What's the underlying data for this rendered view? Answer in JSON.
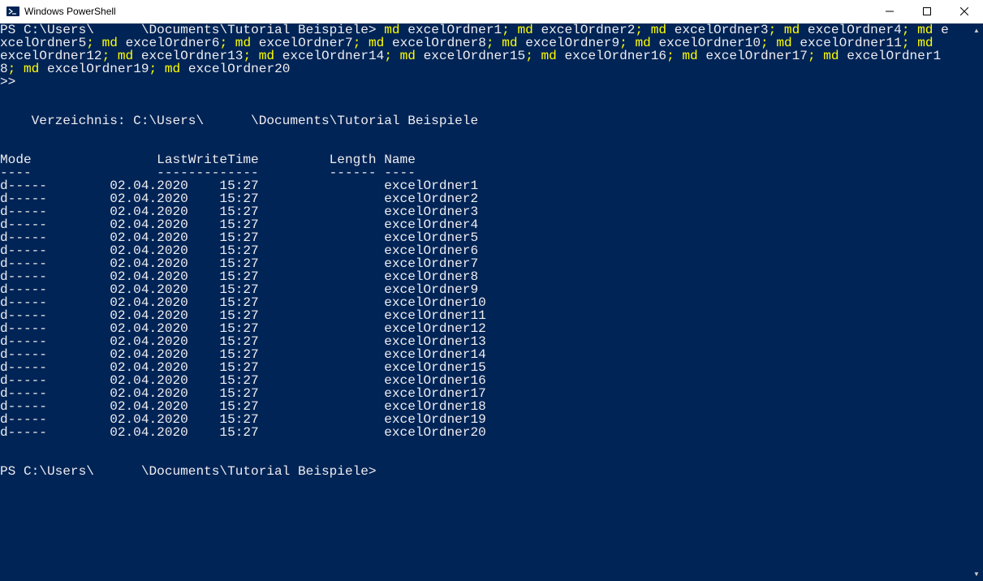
{
  "window": {
    "title": "Windows PowerShell"
  },
  "prompt_path": "PS C:\\Users\\      \\Documents\\Tutorial Beispiele>",
  "cmd": {
    "p0a": "PS C:\\Users\\",
    "p0b": "\\Documents\\Tutorial Beispiele> ",
    "p1": "md ",
    "a1": "excelOrdner1",
    "sep": "; ",
    "a2": "excelOrdner2",
    "a3": "excelOrdner3",
    "a4": "excelOrdner4",
    "tail1a": "md ",
    "tail1b": "e",
    "line2a": "xcelOrdner5",
    "a6": "excelOrdner6",
    "a7": "excelOrdner7",
    "a8": "excelOrdner8",
    "a9": "excelOrdner9",
    "a10": "excelOrdner10",
    "a11": "excelOrdner11",
    "tail2": "md",
    "line3a": "excelOrdner12",
    "a13": "excelOrdner13",
    "a14": "excelOrdner14",
    "a15": "excelOrdner15",
    "a16": "excelOrdner16",
    "a17": "excelOrdner17",
    "tail3a": "md ",
    "tail3b": "excelOrdner1",
    "line4a": "8",
    "a19": "excelOrdner19",
    "a20": "excelOrdner20",
    "cont": ">>"
  },
  "dir_header_label": "    Verzeichnis: C:\\Users\\      \\Documents\\Tutorial Beispiele",
  "columns": {
    "header": "Mode                LastWriteTime         Length Name",
    "sep": "----                -------------         ------ ----"
  },
  "rows": [
    {
      "mode": "d-----",
      "date": "02.04.2020",
      "time": "15:27",
      "length": "",
      "name": "excelOrdner1"
    },
    {
      "mode": "d-----",
      "date": "02.04.2020",
      "time": "15:27",
      "length": "",
      "name": "excelOrdner2"
    },
    {
      "mode": "d-----",
      "date": "02.04.2020",
      "time": "15:27",
      "length": "",
      "name": "excelOrdner3"
    },
    {
      "mode": "d-----",
      "date": "02.04.2020",
      "time": "15:27",
      "length": "",
      "name": "excelOrdner4"
    },
    {
      "mode": "d-----",
      "date": "02.04.2020",
      "time": "15:27",
      "length": "",
      "name": "excelOrdner5"
    },
    {
      "mode": "d-----",
      "date": "02.04.2020",
      "time": "15:27",
      "length": "",
      "name": "excelOrdner6"
    },
    {
      "mode": "d-----",
      "date": "02.04.2020",
      "time": "15:27",
      "length": "",
      "name": "excelOrdner7"
    },
    {
      "mode": "d-----",
      "date": "02.04.2020",
      "time": "15:27",
      "length": "",
      "name": "excelOrdner8"
    },
    {
      "mode": "d-----",
      "date": "02.04.2020",
      "time": "15:27",
      "length": "",
      "name": "excelOrdner9"
    },
    {
      "mode": "d-----",
      "date": "02.04.2020",
      "time": "15:27",
      "length": "",
      "name": "excelOrdner10"
    },
    {
      "mode": "d-----",
      "date": "02.04.2020",
      "time": "15:27",
      "length": "",
      "name": "excelOrdner11"
    },
    {
      "mode": "d-----",
      "date": "02.04.2020",
      "time": "15:27",
      "length": "",
      "name": "excelOrdner12"
    },
    {
      "mode": "d-----",
      "date": "02.04.2020",
      "time": "15:27",
      "length": "",
      "name": "excelOrdner13"
    },
    {
      "mode": "d-----",
      "date": "02.04.2020",
      "time": "15:27",
      "length": "",
      "name": "excelOrdner14"
    },
    {
      "mode": "d-----",
      "date": "02.04.2020",
      "time": "15:27",
      "length": "",
      "name": "excelOrdner15"
    },
    {
      "mode": "d-----",
      "date": "02.04.2020",
      "time": "15:27",
      "length": "",
      "name": "excelOrdner16"
    },
    {
      "mode": "d-----",
      "date": "02.04.2020",
      "time": "15:27",
      "length": "",
      "name": "excelOrdner17"
    },
    {
      "mode": "d-----",
      "date": "02.04.2020",
      "time": "15:27",
      "length": "",
      "name": "excelOrdner18"
    },
    {
      "mode": "d-----",
      "date": "02.04.2020",
      "time": "15:27",
      "length": "",
      "name": "excelOrdner19"
    },
    {
      "mode": "d-----",
      "date": "02.04.2020",
      "time": "15:27",
      "length": "",
      "name": "excelOrdner20"
    }
  ],
  "prompt2": "PS C:\\Users\\      \\Documents\\Tutorial Beispiele>"
}
